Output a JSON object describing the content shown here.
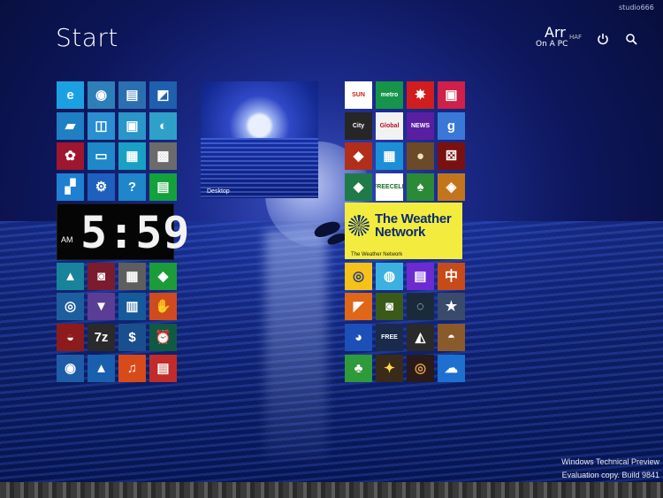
{
  "header": {
    "title": "Start",
    "user_name": "Arr",
    "user_status": "On A PC",
    "avatar_text": "HAF",
    "watermark": "studio666",
    "power_icon": "power-icon",
    "search_icon": "search-icon"
  },
  "clock": {
    "ampm": "AM",
    "time": "5:59"
  },
  "desktop_tile": {
    "label": "Desktop"
  },
  "weather_tile": {
    "name_line1": "The Weather",
    "name_line2": "Network",
    "caption": "The Weather Network",
    "color": "#f3ec3f"
  },
  "left_tiles": [
    {
      "app": "internet-explorer",
      "glyph": "e",
      "bg": "#1ba1e2"
    },
    {
      "app": "firefox",
      "glyph": "◉",
      "bg": "#2d7fb8"
    },
    {
      "app": "file-explorer",
      "glyph": "▤",
      "bg": "#2b6fb0"
    },
    {
      "app": "photos-viewer",
      "glyph": "◩",
      "bg": "#1e5fae"
    },
    {
      "app": "windows-media-center",
      "glyph": "▰",
      "bg": "#1f7fc4"
    },
    {
      "app": "network-center",
      "glyph": "◫",
      "bg": "#2a8ed1"
    },
    {
      "app": "remote-desktop",
      "glyph": "▣",
      "bg": "#2a95c9"
    },
    {
      "app": "paint",
      "glyph": "◐",
      "bg": "#2fa0c8"
    },
    {
      "app": "device-manager",
      "glyph": "✿",
      "bg": "#9e1630"
    },
    {
      "app": "computer",
      "glyph": "▭",
      "bg": "#1e88c8"
    },
    {
      "app": "notepad",
      "glyph": "▦",
      "bg": "#1aa0c4"
    },
    {
      "app": "calculator",
      "glyph": "▩",
      "bg": "#6b6b6b"
    },
    {
      "app": "store-apps",
      "glyph": "▞",
      "bg": "#1f7fd0"
    },
    {
      "app": "settings",
      "glyph": "⚙",
      "bg": "#1f5fbe"
    },
    {
      "app": "help",
      "glyph": "?",
      "bg": "#1e86c9"
    },
    {
      "app": "store",
      "glyph": "▤",
      "bg": "#12a13a"
    },
    {
      "app": "photos",
      "glyph": "▲",
      "bg": "#18839a"
    },
    {
      "app": "camera",
      "glyph": "◙",
      "bg": "#7a1b2e"
    },
    {
      "app": "calculator2",
      "glyph": "▦",
      "bg": "#5e5e5e"
    },
    {
      "app": "xbox-games",
      "glyph": "◆",
      "bg": "#1b9b3a"
    },
    {
      "app": "intel",
      "glyph": "◎",
      "bg": "#1d5f9e"
    },
    {
      "app": "reader",
      "glyph": "▼",
      "bg": "#5c3d95"
    },
    {
      "app": "music-grid",
      "glyph": "▥",
      "bg": "#155a9a"
    },
    {
      "app": "office-lens",
      "glyph": "✋",
      "bg": "#cf4a1f"
    },
    {
      "app": "ccleaner",
      "glyph": "◒",
      "bg": "#8e1b1b"
    },
    {
      "app": "7zip",
      "glyph": "7z",
      "bg": "#2a2a2a"
    },
    {
      "app": "finance",
      "glyph": "$",
      "bg": "#1a4f8e"
    },
    {
      "app": "alarms",
      "glyph": "⏰",
      "bg": "#0e5a42"
    },
    {
      "app": "eye-view",
      "glyph": "◉",
      "bg": "#1f5ca8"
    },
    {
      "app": "vlc",
      "glyph": "▲",
      "bg": "#1a5fae"
    },
    {
      "app": "music",
      "glyph": "♫",
      "bg": "#d84a1a"
    },
    {
      "app": "news",
      "glyph": "▤",
      "bg": "#c12b2b"
    }
  ],
  "right_tiles": [
    {
      "app": "sun-news",
      "glyph": "SUN",
      "bg": "#ffffff",
      "color": "#cc1b1b"
    },
    {
      "app": "metro",
      "glyph": "metro",
      "bg": "#16944a",
      "color": "#ffffff"
    },
    {
      "app": "cbc",
      "glyph": "✸",
      "bg": "#d11d1d",
      "color": "#ffffff"
    },
    {
      "app": "video",
      "glyph": "▣",
      "bg": "#cf2049",
      "color": "#ffffff"
    },
    {
      "app": "city-news",
      "glyph": "City",
      "bg": "#262626",
      "color": "#ffffff"
    },
    {
      "app": "global-news",
      "glyph": "Global",
      "bg": "#f2f2f2",
      "color": "#b7102a"
    },
    {
      "app": "news-channel",
      "glyph": "NEWS",
      "bg": "#5a1fa0",
      "color": "#ffffff"
    },
    {
      "app": "google",
      "glyph": "g",
      "bg": "#3a78d8",
      "color": "#ffffff"
    },
    {
      "app": "fighting-game",
      "glyph": "◆",
      "bg": "#b32d1b",
      "color": "#ffffff"
    },
    {
      "app": "puzzle-game",
      "glyph": "▦",
      "bg": "#1d8fd6",
      "color": "#ffffff"
    },
    {
      "app": "checkers",
      "glyph": "●",
      "bg": "#6b4a2a",
      "color": "#f0e0c0"
    },
    {
      "app": "dice",
      "glyph": "⚄",
      "bg": "#7a1010",
      "color": "#ffffff"
    },
    {
      "app": "mahjong-pins",
      "glyph": "◆",
      "bg": "#1f7a48",
      "color": "#ffffff"
    },
    {
      "app": "freecell",
      "glyph": "FREECELL",
      "bg": "#ffffff",
      "color": "#1a6b2a"
    },
    {
      "app": "solitaire",
      "glyph": "♠",
      "bg": "#2b8a36",
      "color": "#ffffff"
    },
    {
      "app": "trophy-game",
      "glyph": "◈",
      "bg": "#c2761b",
      "color": "#ffffff"
    },
    {
      "app": "minions",
      "glyph": "◎",
      "bg": "#f5c21a",
      "color": "#1f3a8a"
    },
    {
      "app": "cut-the-rope",
      "glyph": "◍",
      "bg": "#3cb0e0",
      "color": "#ffffff"
    },
    {
      "app": "tap-tiles",
      "glyph": "▤",
      "bg": "#6b2bd1",
      "color": "#ffffff"
    },
    {
      "app": "mahjong",
      "glyph": "中",
      "bg": "#c74a1a",
      "color": "#ffffff"
    },
    {
      "app": "racing",
      "glyph": "◤",
      "bg": "#e0661a",
      "color": "#ffffff"
    },
    {
      "app": "zombie",
      "glyph": "◙",
      "bg": "#3a5a1a",
      "color": "#ffffff"
    },
    {
      "app": "pool",
      "glyph": "◌",
      "bg": "#1a2a3a",
      "color": "#ffffff"
    },
    {
      "app": "star-game",
      "glyph": "★",
      "bg": "#3a4a6a",
      "color": "#ffffff"
    },
    {
      "app": "sonic",
      "glyph": "◕",
      "bg": "#1d4fb8",
      "color": "#ffffff"
    },
    {
      "app": "free-cards",
      "glyph": "FREE",
      "bg": "#1a2a4a",
      "color": "#ffffff"
    },
    {
      "app": "hunt-game",
      "glyph": "◭",
      "bg": "#2a2a2a",
      "color": "#ffffff"
    },
    {
      "app": "cowboy",
      "glyph": "◓",
      "bg": "#8a5a2a",
      "color": "#ffffff"
    },
    {
      "app": "cards",
      "glyph": "♣",
      "bg": "#2e9a3a",
      "color": "#ffffff"
    },
    {
      "app": "dream-game",
      "glyph": "✦",
      "bg": "#3a2a1a",
      "color": "#ffd84a"
    },
    {
      "app": "tunnel",
      "glyph": "◎",
      "bg": "#2a1a1a",
      "color": "#e0a040"
    },
    {
      "app": "onedrive",
      "glyph": "☁",
      "bg": "#1d6fd0",
      "color": "#ffffff"
    }
  ],
  "footer": {
    "line1": "Windows Technical Preview",
    "line2": "Evaluation copy. Build 9841"
  }
}
